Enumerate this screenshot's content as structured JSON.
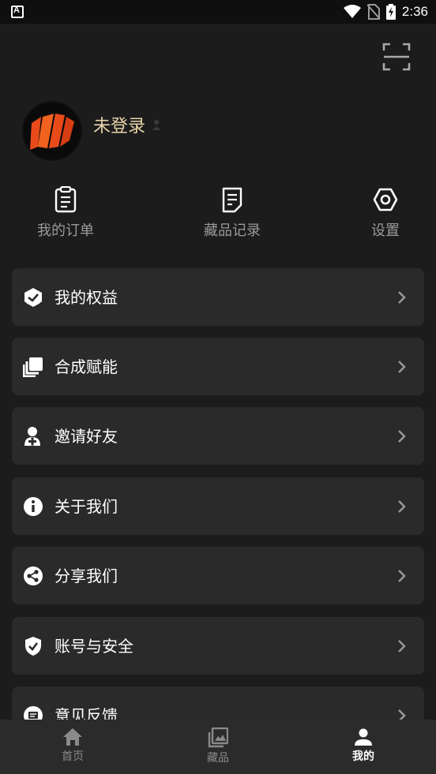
{
  "status_bar": {
    "time": "2:36"
  },
  "profile": {
    "username": "未登录"
  },
  "quick_actions": [
    {
      "label": "我的订单",
      "icon": "order-clipboard-icon"
    },
    {
      "label": "藏品记录",
      "icon": "document-icon"
    },
    {
      "label": "设置",
      "icon": "settings-hexagon-icon"
    }
  ],
  "menu": [
    {
      "label": "我的权益",
      "icon": "rights-badge-icon"
    },
    {
      "label": "合成赋能",
      "icon": "synthesis-layers-icon"
    },
    {
      "label": "邀请好友",
      "icon": "invite-friend-icon"
    },
    {
      "label": "关于我们",
      "icon": "info-icon"
    },
    {
      "label": "分享我们",
      "icon": "share-icon"
    },
    {
      "label": "账号与安全",
      "icon": "shield-check-icon"
    },
    {
      "label": "意见反馈",
      "icon": "feedback-icon"
    }
  ],
  "tabs": [
    {
      "label": "首页",
      "icon": "home-icon",
      "active": false
    },
    {
      "label": "藏品",
      "icon": "image-gallery-icon",
      "active": false
    },
    {
      "label": "我的",
      "icon": "person-icon",
      "active": true
    }
  ],
  "colors": {
    "background": "#1c1c1d",
    "card": "#2a2a2b",
    "username": "#e8d4a8",
    "tabbar": "#2b2b2c"
  }
}
